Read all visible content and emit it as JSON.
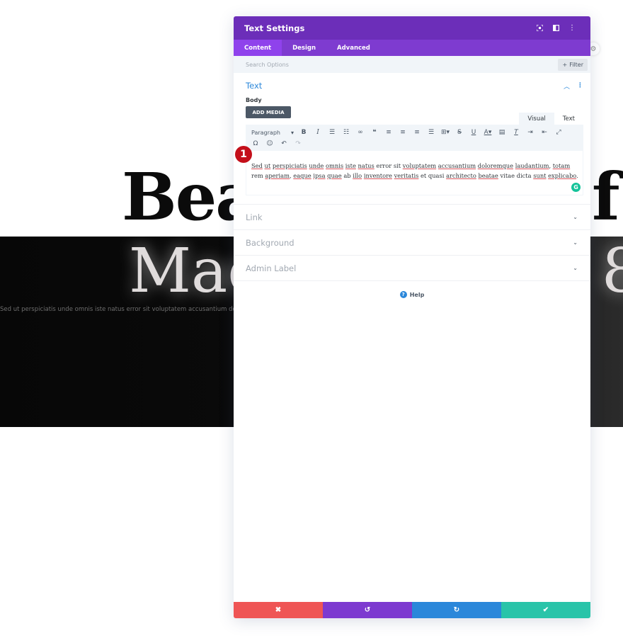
{
  "background": {
    "heading_left": "Bea",
    "heading_right": "f",
    "script_left": "Mac",
    "script_right": "8",
    "body_text": "Sed ut perspiciatis unde omnis iste natus error sit voluptatem accusantium doloremq"
  },
  "modal": {
    "title": "Text Settings",
    "header_icons": [
      "focus-icon",
      "split-view-icon",
      "more-icon"
    ],
    "tabs": [
      {
        "label": "Content",
        "active": true
      },
      {
        "label": "Design",
        "active": false
      },
      {
        "label": "Advanced",
        "active": false
      }
    ],
    "search": {
      "placeholder": "Search Options",
      "value": ""
    },
    "filter_label": "Filter",
    "text_section": {
      "title": "Text",
      "body_label": "Body",
      "add_media_label": "ADD MEDIA",
      "editor_tabs": [
        "Visual",
        "Text"
      ],
      "format_select": "Paragraph",
      "toolbar_row1": [
        "bold",
        "italic",
        "bullet-list",
        "numbered-list",
        "link",
        "blockquote",
        "align-left",
        "align-center",
        "align-right",
        "justify",
        "table",
        "strikethrough",
        "underline",
        "text-color",
        "paste-text",
        "clear-formatting",
        "indent",
        "outdent",
        "fullscreen"
      ],
      "toolbar_row2": [
        "special-char",
        "emoji",
        "undo",
        "redo"
      ],
      "content": "Sed ut perspiciatis unde omnis iste natus error sit voluptatem accusantium doloremque laudantium, totam rem aperiam, eaque ipsa quae ab illo inventore veritatis et quasi architecto beatae vitae dicta sunt explicabo."
    },
    "sections": [
      {
        "title": "Link"
      },
      {
        "title": "Background"
      },
      {
        "title": "Admin Label"
      }
    ],
    "help_label": "Help",
    "step_badge": "1"
  },
  "footer": {
    "cancel": "✖",
    "undo": "↺",
    "redo": "↻",
    "save": "✔"
  },
  "colors": {
    "header": "#6c2eb9",
    "tabs": "#7e3bd0",
    "active_tab": "#8f42ec",
    "accent": "#2b87da",
    "cancel": "#ef5555",
    "undo": "#7d3ad0",
    "redo": "#2b87da",
    "save": "#29c4a9"
  }
}
